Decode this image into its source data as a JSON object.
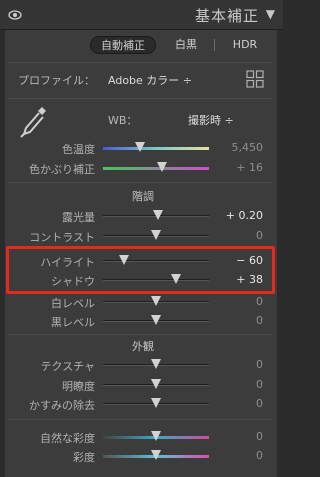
{
  "header": {
    "title": "基本補正",
    "collapse_icon": "triangle-down-icon",
    "visibility_icon": "eye-icon"
  },
  "treatment": {
    "auto_label": "自動補正",
    "bw_label": "白黒",
    "hdr_label": "HDR"
  },
  "profile": {
    "label": "プロファイル：",
    "value": "Adobe カラー ÷",
    "browse_icon": "grid-icon"
  },
  "wb": {
    "label": "WB：",
    "value": "撮影時 ÷",
    "picker_icon": "eyedropper-icon"
  },
  "sliders_wb": [
    {
      "label": "色温度",
      "value": "5,450",
      "level": 0.35
    },
    {
      "label": "色かぶり補正",
      "value": "+ 16",
      "level": 0.56
    }
  ],
  "tone": {
    "title": "階調",
    "sliders": [
      {
        "label": "露光量",
        "value": "+ 0.20",
        "level": 0.52,
        "active": true
      },
      {
        "label": "コントラスト",
        "value": "0",
        "level": 0.5
      },
      {
        "label": "ハイライト",
        "value": "− 60",
        "level": 0.2,
        "active": true
      },
      {
        "label": "シャドウ",
        "value": "+ 38",
        "level": 0.69,
        "active": true
      },
      {
        "label": "白レベル",
        "value": "0",
        "level": 0.5
      },
      {
        "label": "黒レベル",
        "value": "0",
        "level": 0.5
      }
    ]
  },
  "presence": {
    "title": "外観",
    "sliders": [
      {
        "label": "テクスチャ",
        "value": "0",
        "level": 0.5
      },
      {
        "label": "明瞭度",
        "value": "0",
        "level": 0.5
      },
      {
        "label": "かすみの除去",
        "value": "0",
        "level": 0.5
      }
    ],
    "color_sliders": [
      {
        "label": "自然な彩度",
        "value": "0",
        "level": 0.5
      },
      {
        "label": "彩度",
        "value": "0",
        "level": 0.5
      }
    ]
  },
  "accent_colors": {
    "highlight_box": "#e7291b",
    "panel_bg": "#3c3c3c",
    "header_bg": "#353535"
  }
}
